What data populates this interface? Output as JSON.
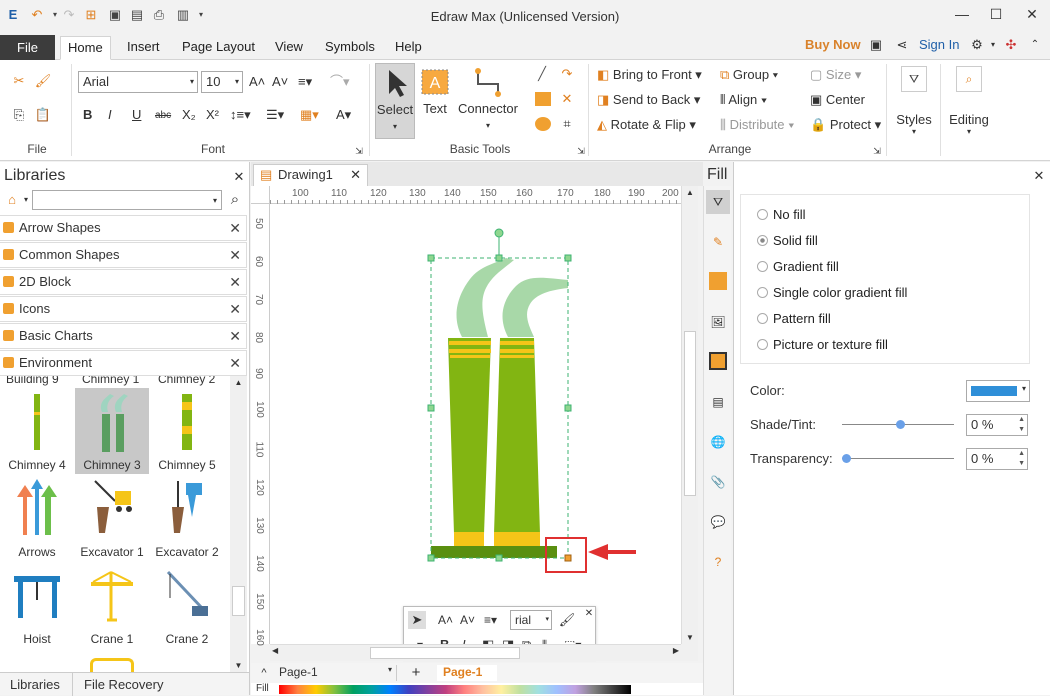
{
  "title_bar": {
    "title": "Edraw Max (Unlicensed Version)"
  },
  "menu": {
    "file": "File",
    "tabs": [
      "Home",
      "Insert",
      "Page Layout",
      "View",
      "Symbols",
      "Help"
    ],
    "buy_now": "Buy Now",
    "sign_in": "Sign In"
  },
  "ribbon": {
    "font_name": "Arial",
    "font_size": "10",
    "groups": {
      "file": "File",
      "font": "Font",
      "basic_tools": "Basic Tools",
      "arrange": "Arrange"
    },
    "tools": {
      "select": "Select",
      "text": "Text",
      "connector": "Connector"
    },
    "arrange": {
      "bring_to_front": "Bring to Front",
      "send_to_back": "Send to Back",
      "rotate_flip": "Rotate & Flip",
      "group": "Group",
      "align": "Align",
      "distribute": "Distribute",
      "size": "Size",
      "center": "Center",
      "protect": "Protect"
    },
    "styles": "Styles",
    "editing": "Editing"
  },
  "libraries": {
    "title": "Libraries",
    "categories": [
      "Arrow Shapes",
      "Common Shapes",
      "2D Block",
      "Icons",
      "Basic Charts",
      "Environment"
    ],
    "partial_labels": [
      "Building 9",
      "Chimney 1",
      "Chimney 2"
    ],
    "shapes": [
      "Chimney 4",
      "Chimney 3",
      "Chimney 5",
      "Arrows",
      "Excavator 1",
      "Excavator 2",
      "Hoist",
      "Crane 1",
      "Crane 2"
    ],
    "bottom_tabs": [
      "Libraries",
      "File Recovery"
    ]
  },
  "document": {
    "tab": "Drawing1",
    "page_tab": "Page-1",
    "active_page": "Page-1",
    "fill_label": "Fill",
    "h_ruler": [
      "100",
      "110",
      "120",
      "130",
      "140",
      "150",
      "160",
      "170",
      "180",
      "190",
      "200"
    ],
    "v_ruler": [
      "50",
      "60",
      "70",
      "80",
      "90",
      "100",
      "110",
      "120",
      "130",
      "140",
      "150",
      "160"
    ]
  },
  "float_toolbar": {
    "font": "rial"
  },
  "fill_panel": {
    "title": "Fill",
    "options": [
      "No fill",
      "Solid fill",
      "Gradient fill",
      "Single color gradient fill",
      "Pattern fill",
      "Picture or texture fill"
    ],
    "selected": "Solid fill",
    "color_label": "Color:",
    "color_value": "#2f8fd8",
    "shade_label": "Shade/Tint:",
    "shade_value": "0 %",
    "transparency_label": "Transparency:",
    "transparency_value": "0 %"
  },
  "colors": {
    "accent_orange": "#f0a030",
    "chimney_green": "#82b512",
    "selection_green": "#3cb371",
    "callout_red": "#e03030"
  }
}
